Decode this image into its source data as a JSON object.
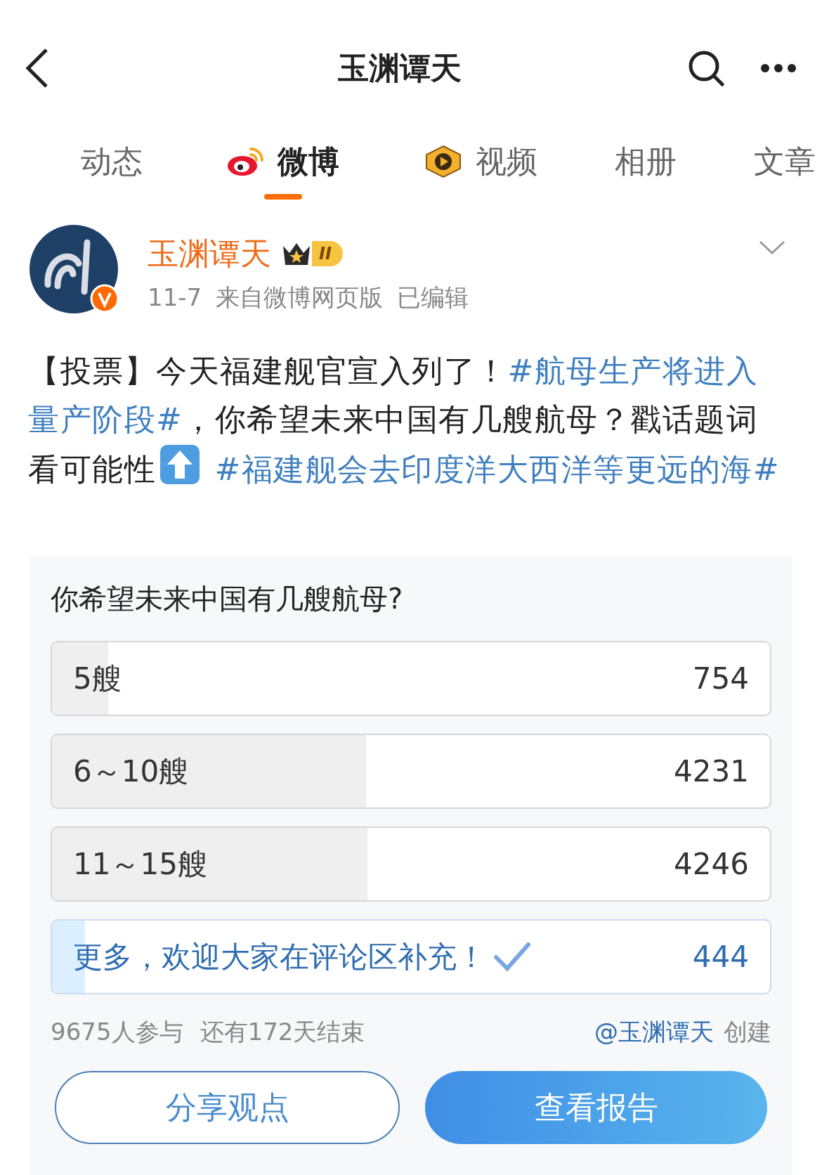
{
  "header": {
    "title": "玉渊谭天"
  },
  "tabs": [
    {
      "label": "动态",
      "selected": false,
      "kind": "plain"
    },
    {
      "label": "微博",
      "selected": true,
      "kind": "weibo"
    },
    {
      "label": "视频",
      "selected": false,
      "kind": "video"
    },
    {
      "label": "相册",
      "selected": false,
      "kind": "plain"
    },
    {
      "label": "文章",
      "selected": false,
      "kind": "plain"
    }
  ],
  "post": {
    "author": "玉渊谭天",
    "verified": true,
    "badge": "II",
    "meta": [
      "11-7",
      "来自微博网页版",
      "已编辑"
    ],
    "body": [
      {
        "kind": "text",
        "text": "【投票】今天福建舰官宣入列了！"
      },
      {
        "kind": "hashtag",
        "text": "#航母生产将进入量产阶段#"
      },
      {
        "kind": "text",
        "text": "，你希望未来中国有几艘航母？戳话题词看可能性"
      },
      {
        "kind": "icon"
      },
      {
        "kind": "hashtag",
        "text": " #福建舰会去印度洋大西洋等更远的海#"
      }
    ]
  },
  "poll": {
    "question": "你希望未来中国有几艘航母?",
    "options": [
      {
        "label": "5艘",
        "count": "754",
        "level": 0.078,
        "selected": false
      },
      {
        "label": "6～10艘",
        "count": "4231",
        "level": 0.437,
        "selected": false
      },
      {
        "label": "11～15艘",
        "count": "4246",
        "level": 0.439,
        "selected": false
      },
      {
        "label": "更多，欢迎大家在评论区补充！",
        "count": "444",
        "level": 0.046,
        "selected": true
      }
    ],
    "participants": "9675人参与",
    "remaining": "还有172天结束",
    "creator": "@玉渊谭天",
    "created": "创建",
    "buttons": [
      {
        "label": "分享观点",
        "kind": "outline"
      },
      {
        "label": "查看报告",
        "kind": "primary"
      }
    ]
  }
}
